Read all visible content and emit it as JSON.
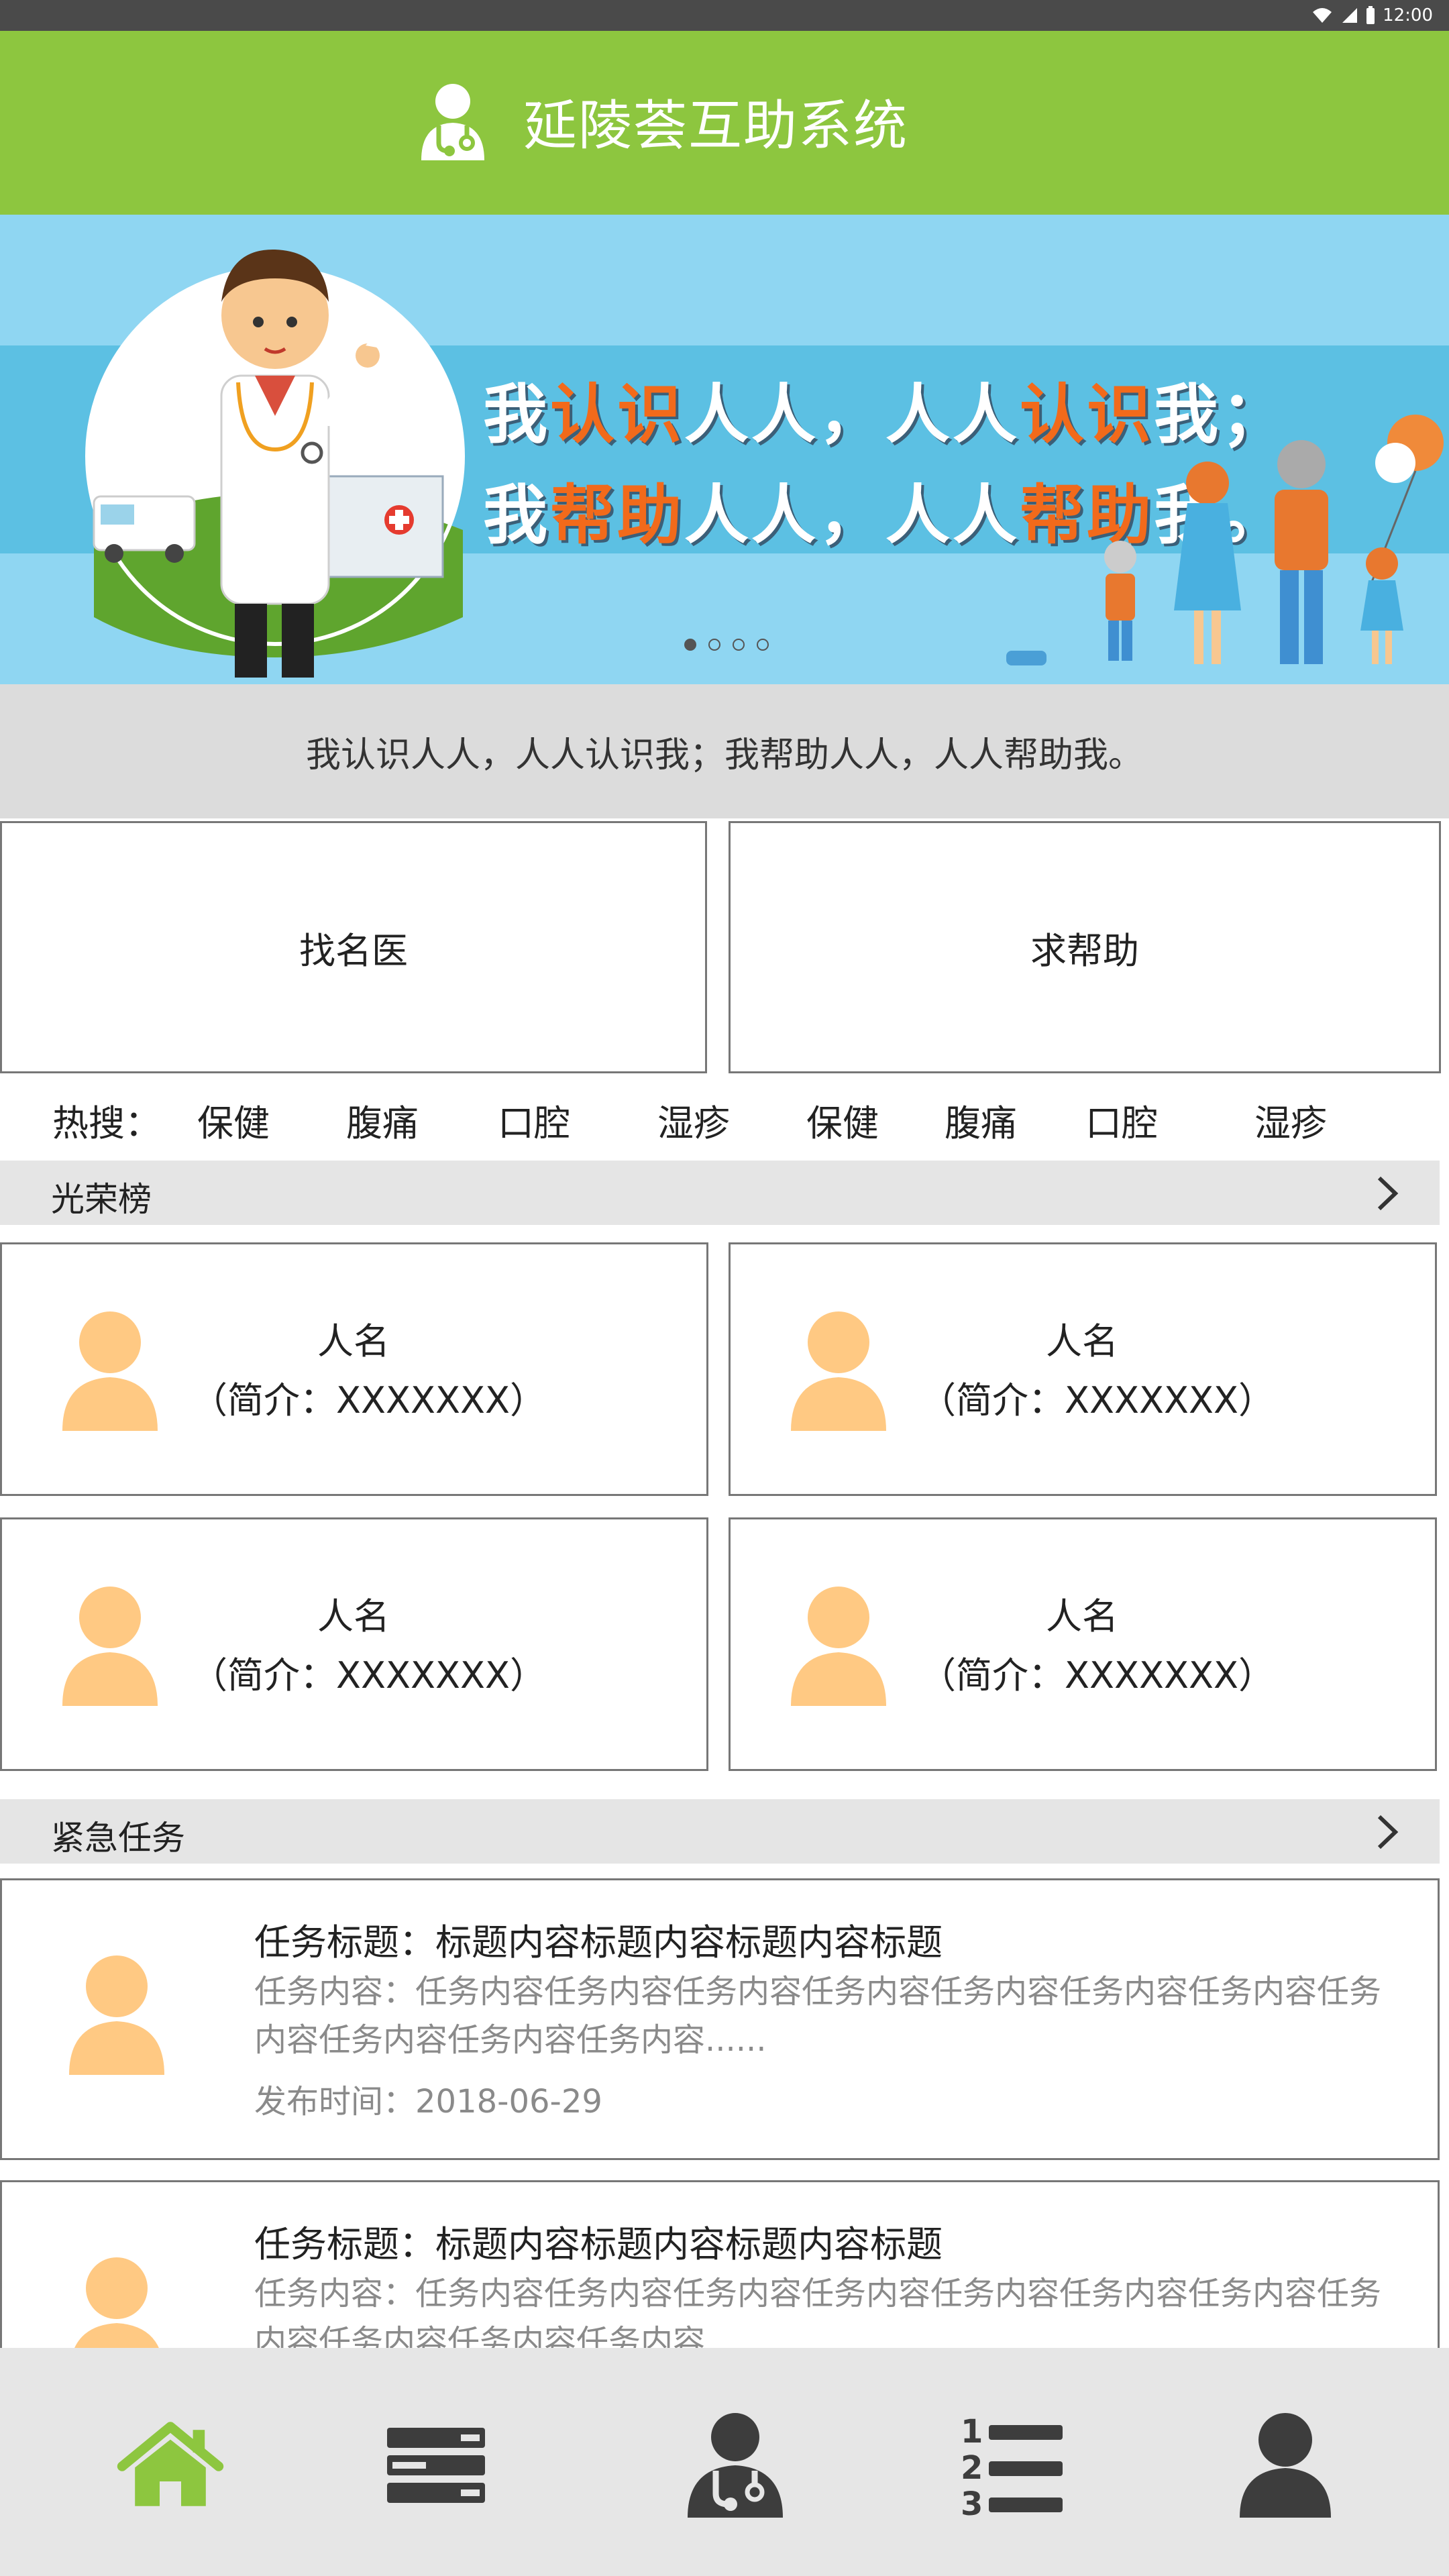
{
  "status_bar": {
    "time": "12:00"
  },
  "header": {
    "title": "延陵荟互助系统",
    "icon": "doctor-icon"
  },
  "banner": {
    "line1": {
      "a": "我",
      "b": "认识",
      "c": "人人，人人",
      "d": "认识",
      "e": "我；"
    },
    "line2": {
      "a": "我",
      "b": "帮助",
      "c": "人人，人人",
      "d": "帮助",
      "e": "我。"
    },
    "carousel_pages": 4,
    "active_page": 1
  },
  "slogan": "我认识人人，人人认识我；我帮助人人，人人帮助我。",
  "actions": {
    "find_doctor": "找名医",
    "ask_help": "求帮助"
  },
  "hot_search": {
    "label": "热搜：",
    "keywords": [
      "保健",
      "腹痛",
      "口腔",
      "湿疹",
      "保健",
      "腹痛",
      "口腔",
      "湿疹"
    ]
  },
  "honor_section": {
    "title": "光荣榜"
  },
  "honor_cards": [
    {
      "name": "人名",
      "intro": "（简介：XXXXXXX）"
    },
    {
      "name": "人名",
      "intro": "（简介：XXXXXXX）"
    },
    {
      "name": "人名",
      "intro": "（简介：XXXXXXX）"
    },
    {
      "name": "人名",
      "intro": "（简介：XXXXXXX）"
    }
  ],
  "urgent_section": {
    "title": "紧急任务"
  },
  "tasks": [
    {
      "title": "任务标题：标题内容标题内容标题内容标题",
      "content": "任务内容：任务内容任务内容任务内容任务内容任务内容任务内容任务内容任务内容任务内容任务内容任务内容......",
      "time": "发布时间：2018-06-29"
    },
    {
      "title": "任务标题：标题内容标题内容标题内容标题",
      "content": "任务内容：任务内容任务内容任务内容任务内容任务内容任务内容任务内容任务内容任务内容任务内容任务内容......",
      "time": ""
    }
  ],
  "tabbar": {
    "items": [
      "home-icon",
      "list-icon",
      "doctor-icon",
      "ranking-icon",
      "user-icon"
    ],
    "active": "home-icon"
  },
  "colors": {
    "brand_green": "#8dc63f",
    "avatar": "#ffc983",
    "tab_inactive": "#3d3d3d"
  }
}
